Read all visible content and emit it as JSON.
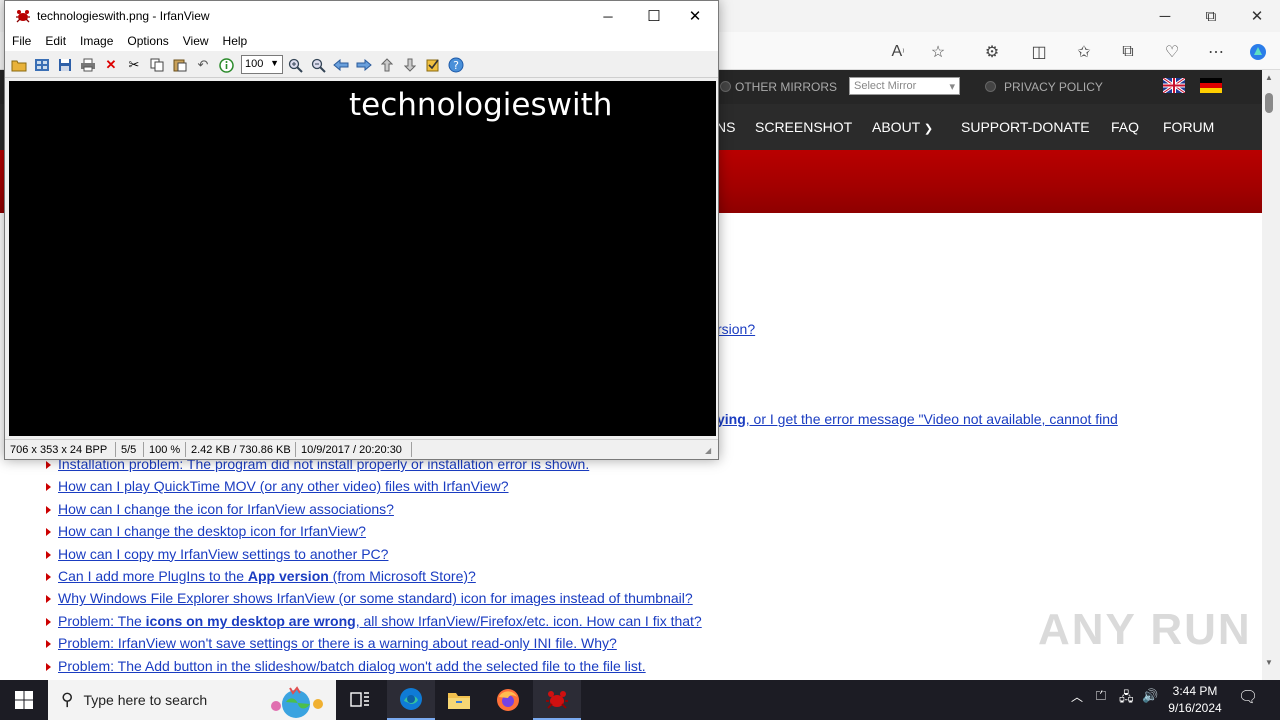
{
  "edge": {
    "window_controls": {
      "minimize": "─",
      "maximize": "⧉",
      "close": "✕"
    }
  },
  "site": {
    "mirror_label": "OTHER MIRRORS",
    "select_mirror": "Select Mirror",
    "privacy": "PRIVACY POLICY",
    "nav": [
      {
        "label": "NS"
      },
      {
        "label": "SCREENSHOT"
      },
      {
        "label": "ABOUT"
      },
      {
        "label": "SUPPORT-DONATE"
      },
      {
        "label": "FAQ"
      },
      {
        "label": "FORUM"
      }
    ],
    "partial_links": {
      "version_tail": "rsion?",
      "playing_bold": "ying",
      "playing_tail": ", or I get the error message \"Video not available, cannot find"
    },
    "faq": [
      {
        "pre": "Installation problem: The program did not install properly or installation error is shown.",
        "bold": "",
        "post": ""
      },
      {
        "pre": "How can I play QuickTime MOV (or any other video) files with IrfanView?",
        "bold": "",
        "post": ""
      },
      {
        "pre": "How can I change the icon for IrfanView associations?",
        "bold": "",
        "post": ""
      },
      {
        "pre": "How can I change the desktop icon for IrfanView?",
        "bold": "",
        "post": ""
      },
      {
        "pre": "How can I copy my IrfanView settings to another PC?",
        "bold": "",
        "post": ""
      },
      {
        "pre": "Can I add more PlugIns to the ",
        "bold": "App version",
        "post": " (from Microsoft Store)?"
      },
      {
        "pre": "Why Windows File Explorer shows IrfanView (or some standard) icon for images instead of thumbnail?",
        "bold": "",
        "post": ""
      },
      {
        "pre": "Problem: The ",
        "bold": "icons on my desktop are wrong",
        "post": ", all show IrfanView/Firefox/etc. icon. How can I fix that?"
      },
      {
        "pre": "Problem: IrfanView won't save settings or there is a warning about read-only INI file. Why?",
        "bold": "",
        "post": ""
      },
      {
        "pre": "Problem: The Add button in the slideshow/batch dialog won't add the selected file to the file list.",
        "bold": "",
        "post": ""
      }
    ]
  },
  "irfanview": {
    "title": "technologieswith.png - IrfanView",
    "menu": [
      "File",
      "Edit",
      "Image",
      "Options",
      "View",
      "Help"
    ],
    "zoom_value": "100",
    "image_text": "technologieswith",
    "status": {
      "dims": "706 x 353 x 24 BPP",
      "index": "5/5",
      "zoom": "100 %",
      "size": "2.42 KB / 730.86 KB",
      "date": "10/9/2017 / 20:20:30"
    },
    "controls": {
      "minimize": "─",
      "maximize": "☐",
      "close": "✕"
    }
  },
  "taskbar": {
    "search_placeholder": "Type here to search",
    "time": "3:44 PM",
    "date": "9/16/2024"
  },
  "watermark": "ANY RUN"
}
